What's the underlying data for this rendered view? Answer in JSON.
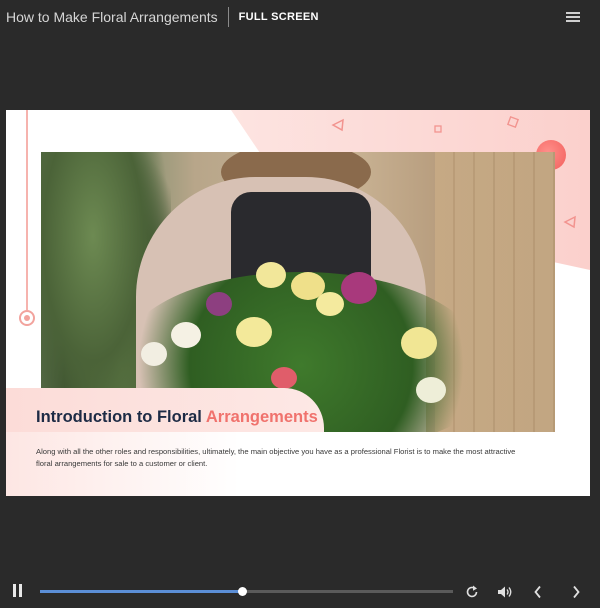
{
  "header": {
    "title": "How to Make Floral Arrangements",
    "fullscreen_label": "FULL SCREEN",
    "menu_icon": "hamburger-icon"
  },
  "slide": {
    "heading_main": "Introduction to Floral",
    "heading_accent": "Arrangements",
    "body": "Along with all the other roles and responsibilities, ultimately, the main objective you have as a professional Florist is to make the most attractive floral arrangements for sale to a customer or client.",
    "accent_color": "#f0726d",
    "heading_color": "#1d2b45"
  },
  "player": {
    "progress": 0.49,
    "icons": {
      "pause": "pause-icon",
      "replay": "replay-icon",
      "volume": "volume-icon",
      "previous": "chevron-left-icon",
      "next": "chevron-right-icon"
    },
    "progress_color": "#5b8ed6"
  }
}
